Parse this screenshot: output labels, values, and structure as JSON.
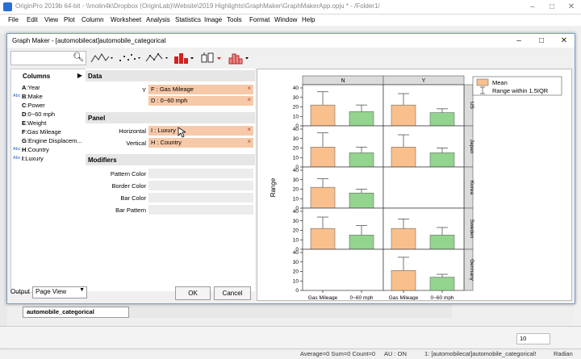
{
  "app": {
    "title": "OriginPro 2019b 64-bit - \\\\molin4k\\Dropbox (OriginLab)\\Website\\2019 Highlights\\GraphMaker\\GraphMakerApp.opju * - /Folder1/",
    "menu": [
      "File",
      "Edit",
      "View",
      "Plot",
      "Column",
      "Worksheet",
      "Analysis",
      "Statistics",
      "Image",
      "Tools",
      "Format",
      "Window",
      "Help"
    ],
    "worksheet_tab": "automobile_categorical",
    "status": {
      "stats": "Average=0 Sum=0 Count=0",
      "au": "AU : ON",
      "book": "1: [automobilecat]automobile_categorical!",
      "unit": "Radian"
    },
    "zoom_value": "10"
  },
  "dialog": {
    "title": "Graph Maker - [automobilecat]automobile_categorical",
    "search": {
      "placeholder": ""
    },
    "columns_header": "Columns",
    "columns": [
      {
        "letter": "A",
        "name": "Year",
        "badge": ""
      },
      {
        "letter": "B",
        "name": "Make",
        "badge": "Abc"
      },
      {
        "letter": "C",
        "name": "Power",
        "badge": ""
      },
      {
        "letter": "D",
        "name": "0~60 mph",
        "badge": ""
      },
      {
        "letter": "E",
        "name": "Weight",
        "badge": ""
      },
      {
        "letter": "F",
        "name": "Gas Mileage",
        "badge": ""
      },
      {
        "letter": "G",
        "name": "Engine Displacem...",
        "badge": ""
      },
      {
        "letter": "H",
        "name": "Country",
        "badge": "Abc"
      },
      {
        "letter": "I",
        "name": "Luxury",
        "badge": "Abc"
      }
    ],
    "sections": {
      "data": "Data",
      "panel": "Panel",
      "modifiers": "Modifiers"
    },
    "data_y_label": "Y",
    "data_y_values": [
      "F : Gas Mileage",
      "D : 0~60 mph"
    ],
    "panel": {
      "horizontal_label": "Horizontal",
      "horizontal_value": "I : Luxury",
      "vertical_label": "Vertical",
      "vertical_value": "H : Country"
    },
    "modifiers": [
      "Pattern Color",
      "Border Color",
      "Bar Color",
      "Bar Pattern"
    ],
    "output_label": "Output",
    "output_value": "Page View",
    "ok_label": "OK",
    "cancel_label": "Cancel",
    "remove_glyph": "×"
  },
  "chart_data": {
    "type": "bar",
    "ylabel": "Range",
    "ylim": [
      0,
      40
    ],
    "yticks": [
      0,
      10,
      20,
      30,
      40
    ],
    "categories": [
      "Gas Mileage",
      "0~60 mph"
    ],
    "columns": [
      "N",
      "Y"
    ],
    "rows": [
      "US",
      "Japan",
      "Korea",
      "Sweden",
      "Germany"
    ],
    "legend": {
      "items": [
        "Mean",
        "Range within 1.5IQR"
      ],
      "position": "top-right"
    },
    "series_colors": {
      "Gas Mileage": "#f9c08d",
      "0~60 mph": "#93d48e"
    },
    "panels": [
      {
        "row": "US",
        "col": "N",
        "means": [
          22,
          15
        ],
        "upper": [
          36,
          22
        ]
      },
      {
        "row": "US",
        "col": "Y",
        "means": [
          22,
          14
        ],
        "upper": [
          34,
          18
        ]
      },
      {
        "row": "Japan",
        "col": "N",
        "means": [
          21,
          15
        ],
        "upper": [
          36,
          21
        ]
      },
      {
        "row": "Japan",
        "col": "Y",
        "means": [
          21,
          15
        ],
        "upper": [
          34,
          20
        ]
      },
      {
        "row": "Korea",
        "col": "N",
        "means": [
          22,
          16
        ],
        "upper": [
          31,
          20
        ]
      },
      {
        "row": "Korea",
        "col": "Y",
        "means": null,
        "upper": null
      },
      {
        "row": "Sweden",
        "col": "N",
        "means": [
          22,
          15
        ],
        "upper": [
          34,
          25
        ]
      },
      {
        "row": "Sweden",
        "col": "Y",
        "means": [
          22,
          15
        ],
        "upper": [
          32,
          23
        ]
      },
      {
        "row": "Germany",
        "col": "N",
        "means": null,
        "upper": null
      },
      {
        "row": "Germany",
        "col": "Y",
        "means": [
          21,
          14
        ],
        "upper": [
          35,
          17
        ]
      }
    ]
  }
}
